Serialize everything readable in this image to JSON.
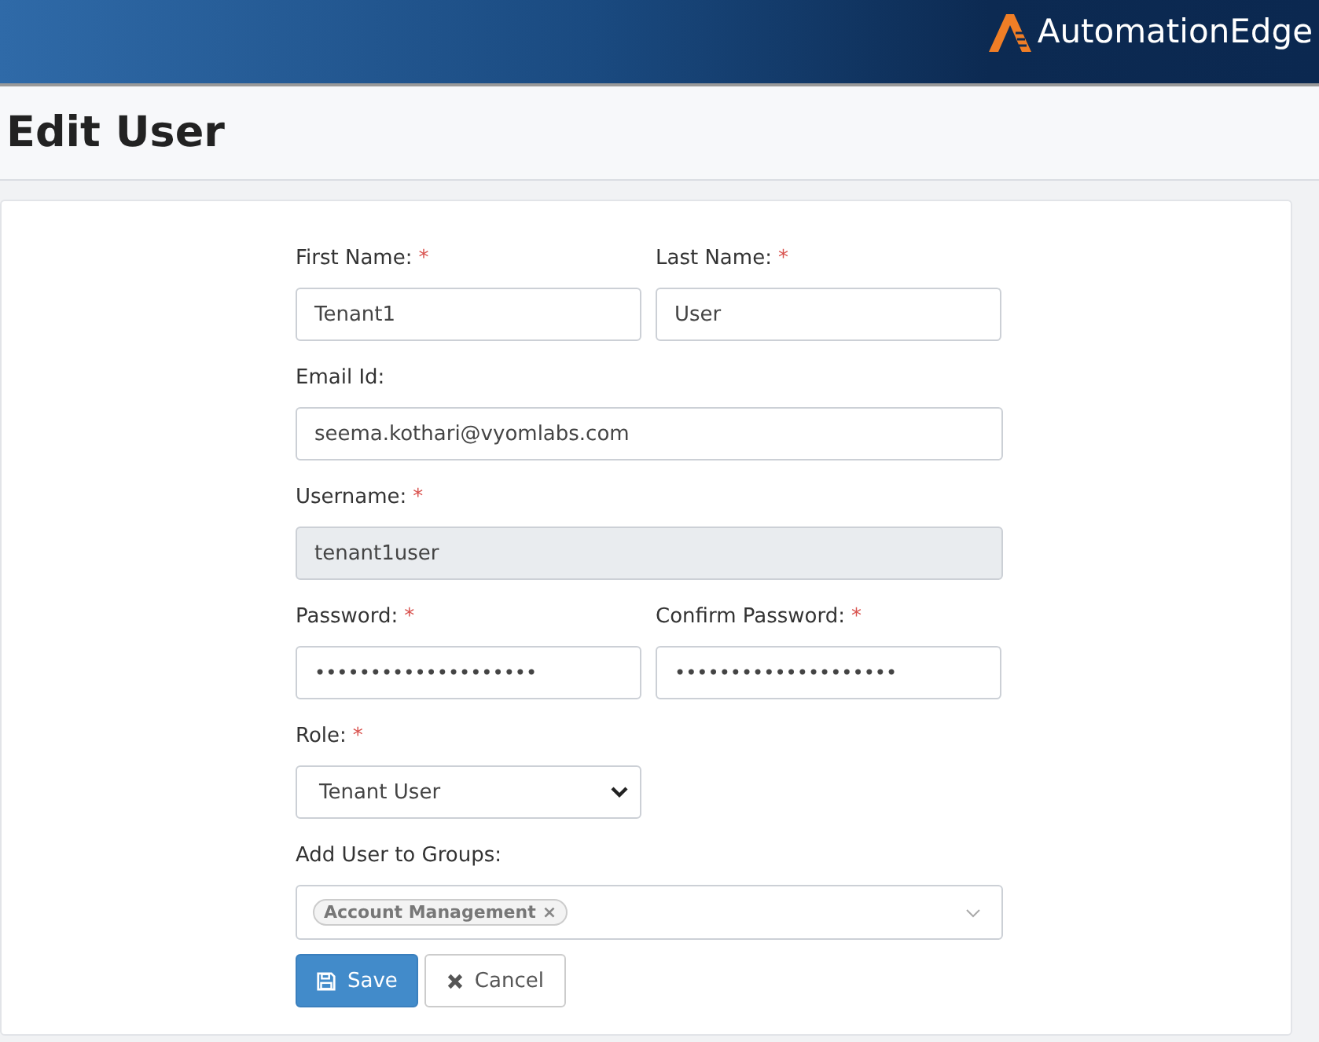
{
  "header": {
    "brand": "AutomationEdge"
  },
  "page": {
    "title": "Edit User"
  },
  "form": {
    "rows": [
      [
        {
          "kind": "text",
          "label": "First Name:",
          "mark": "*",
          "value": "Tenant1"
        },
        {
          "kind": "text",
          "label": "Last Name:",
          "mark": "*",
          "value": "User"
        }
      ],
      [
        {
          "kind": "text",
          "label": "Email Id:",
          "value": "seema.kothari@vyomlabs.com"
        }
      ],
      [
        {
          "kind": "readonly",
          "label": "Username:",
          "mark": "*",
          "value": "tenant1user"
        }
      ],
      [
        {
          "kind": "password",
          "label": "Password:",
          "mark": "*",
          "value": "••••••••••••••••••••"
        },
        {
          "kind": "password",
          "label": "Confirm Password:",
          "mark": "*",
          "value": "••••••••••••••••••••"
        }
      ],
      [
        {
          "kind": "select",
          "label": "Role:",
          "mark": "*",
          "value": "Tenant User"
        }
      ],
      [
        {
          "kind": "tags",
          "label": "Add User to Groups:",
          "tags": [
            {
              "label": "Account Management",
              "remove": "×"
            }
          ]
        }
      ]
    ],
    "buttons": [
      {
        "kind": "save",
        "label": "Save"
      },
      {
        "kind": "cancel",
        "label": "Cancel"
      }
    ]
  }
}
